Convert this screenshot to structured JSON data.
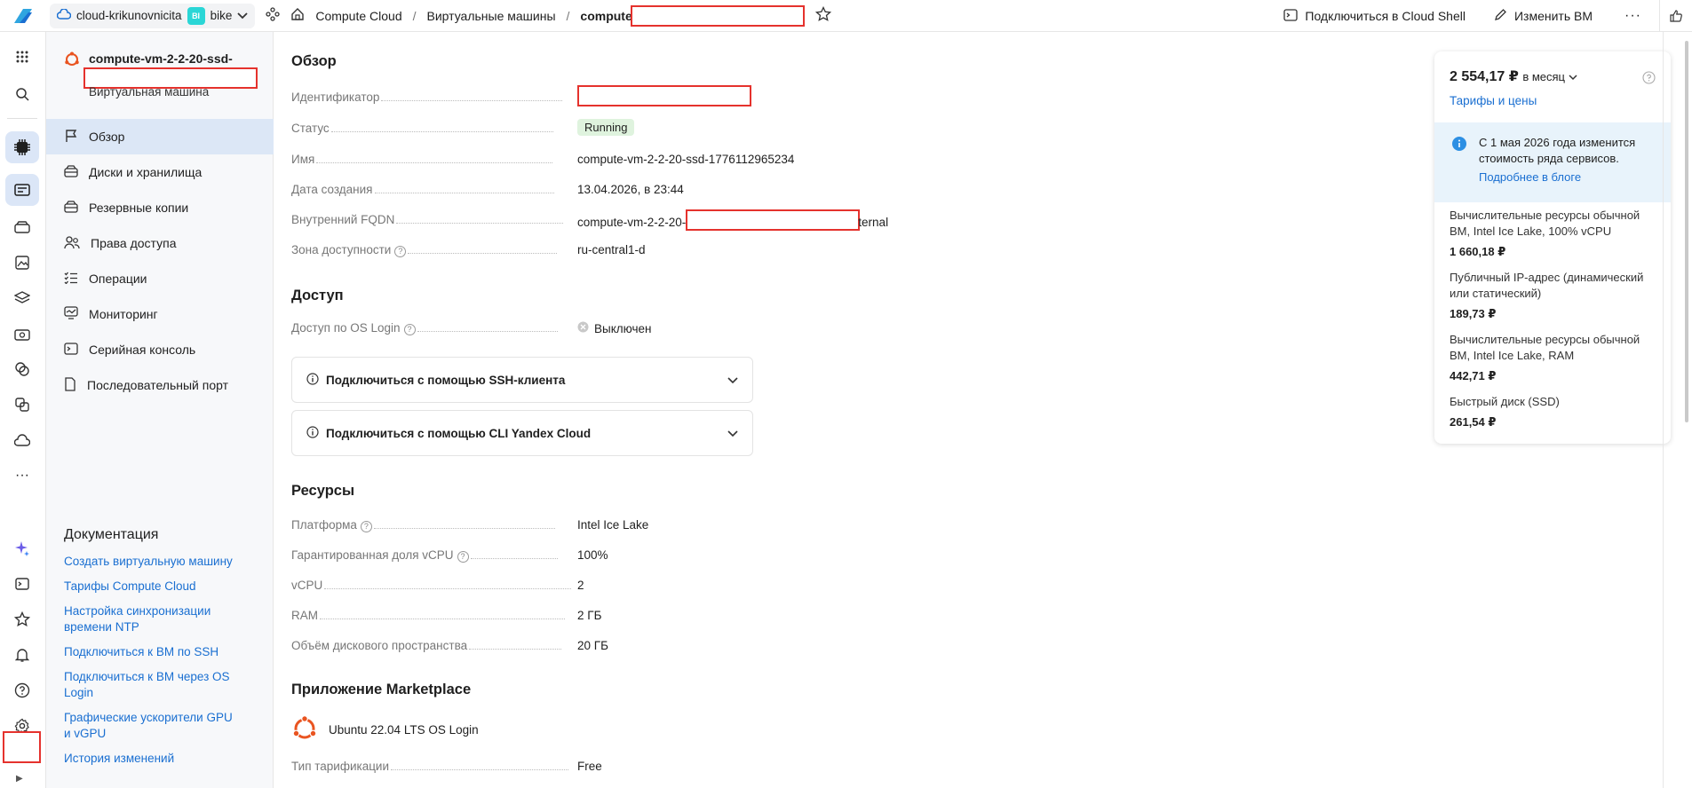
{
  "topbar": {
    "cloud_name": "cloud-krikunovnicita",
    "folder_badge": "BI",
    "folder_name": "bike",
    "crumbs": [
      "Compute Cloud",
      "Виртуальные машины",
      "compute"
    ],
    "connect_shell": "Подключиться в Cloud Shell",
    "edit_vm": "Изменить ВМ",
    "more": "···"
  },
  "service_nav": {
    "vm_title": "compute-vm-2-2-20-ssd-",
    "vm_subtitle": "Виртуальная машина",
    "items": [
      {
        "label": "Обзор",
        "icon": "flag-icon"
      },
      {
        "label": "Диски и хранилища",
        "icon": "disk-icon"
      },
      {
        "label": "Резервные копии",
        "icon": "backup-icon"
      },
      {
        "label": "Права доступа",
        "icon": "users-icon"
      },
      {
        "label": "Операции",
        "icon": "list-icon"
      },
      {
        "label": "Мониторинг",
        "icon": "monitor-icon"
      },
      {
        "label": "Серийная консоль",
        "icon": "terminal-icon"
      },
      {
        "label": "Последовательный порт",
        "icon": "file-icon"
      }
    ],
    "docs_title": "Документация",
    "docs_links": [
      "Создать виртуальную машину",
      "Тарифы Compute Cloud",
      "Настройка синхронизации времени NTP",
      "Подключиться к ВМ по SSH",
      "Подключиться к ВМ через OS Login",
      "Графические ускорители GPU и vGPU",
      "История изменений"
    ]
  },
  "overview": {
    "title": "Обзор",
    "id_label": "Идентификатор",
    "status_label": "Статус",
    "status_value": "Running",
    "name_label": "Имя",
    "name_value": "compute-vm-2-2-20-ssd-1776112965234",
    "created_label": "Дата создания",
    "created_value": "13.04.2026, в 23:44",
    "fqdn_label": "Внутренний FQDN",
    "fqdn_value_start": "compute-vm-2-2-20-",
    "fqdn_value_end": "ternal",
    "zone_label": "Зона доступности",
    "zone_value": "ru-central1-d"
  },
  "access": {
    "title": "Доступ",
    "oslogin_label": "Доступ по OS Login",
    "oslogin_value": "Выключен",
    "ssh_expander": "Подключиться с помощью SSH-клиента",
    "cli_expander": "Подключиться с помощью CLI Yandex Cloud"
  },
  "resources": {
    "title": "Ресурсы",
    "platform_label": "Платформа",
    "platform_value": "Intel Ice Lake",
    "vcpu_share_label": "Гарантированная доля vCPU",
    "vcpu_share_value": "100%",
    "vcpu_label": "vCPU",
    "vcpu_value": "2",
    "ram_label": "RAM",
    "ram_value": "2 ГБ",
    "disk_label": "Объём дискового пространства",
    "disk_value": "20 ГБ"
  },
  "marketplace": {
    "title": "Приложение Marketplace",
    "product": "Ubuntu 22.04 LTS OS Login",
    "billing_label": "Тип тарификации",
    "billing_value": "Free"
  },
  "price": {
    "total": "2 554,17 ₽",
    "period": "в месяц",
    "tariffs_link": "Тарифы и цены",
    "info_text": "С 1 мая 2026 года изменится стоимость ряда сервисов.",
    "info_link": "Подробнее в блоге",
    "items": [
      {
        "name": "Вычислительные ресурсы обычной ВМ, Intel Ice Lake, 100% vCPU",
        "value": "1 660,18 ₽"
      },
      {
        "name": "Публичный IP-адрес (динамический или статический)",
        "value": "189,73 ₽"
      },
      {
        "name": "Вычислительные ресурсы обычной ВМ, Intel Ice Lake, RAM",
        "value": "442,71 ₽"
      },
      {
        "name": "Быстрый диск (SSD)",
        "value": "261,54 ₽"
      }
    ]
  },
  "colors": {
    "accent": "#1a6fd1",
    "status_green": "#2b8a2b",
    "ubuntu_orange": "#e95420",
    "redact": "#e5322d"
  }
}
